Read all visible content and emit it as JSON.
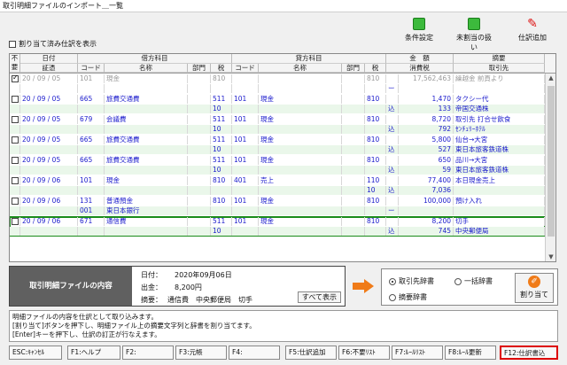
{
  "window": {
    "title": "取引明細ファイルのインポート＿一覧"
  },
  "toolbar": {
    "unallocated_label": "割り当て済み仕訳を表示",
    "condition_label": "条件設定",
    "unallocated_handling_label": "未割当の扱い",
    "add_entry_label": "仕訳追加"
  },
  "grid": {
    "headers": {
      "fuyo": "不要",
      "date": "日付",
      "voucher": "証憑",
      "debit_group": "借方科目",
      "credit_group": "貸方科目",
      "code": "コード",
      "name": "名称",
      "dept": "部門",
      "tax": "税",
      "amount_group": "金　額",
      "consumption_tax": "消費税",
      "summary_group": "摘要",
      "partner": "取引先"
    },
    "rows": [
      {
        "date": "20 / 09 / 05",
        "dcode": "101",
        "dname": "現金",
        "dtax": "810",
        "ccode": "",
        "cname": "",
        "ctax": "810",
        "amount": "17,562,463",
        "summary": "繰越金 前頁より",
        "checked": true,
        "gray": true,
        "sub": {
          "dtax": "",
          "ctax": "",
          "ztype": "ー",
          "ztax": "",
          "partner": ""
        }
      },
      {
        "date": "20 / 09 / 05",
        "dcode": "665",
        "dname": "旅費交通費",
        "dtax": "511",
        "ccode": "101",
        "cname": "現金",
        "ctax": "810",
        "amount": "1,470",
        "summary": "タクシー代",
        "sub": {
          "dtax": "10",
          "ctax": "",
          "ztype": "込",
          "ztax": "133",
          "partner": "帝国交通株"
        }
      },
      {
        "date": "20 / 09 / 05",
        "dcode": "679",
        "dname": "会議費",
        "dtax": "511",
        "ccode": "101",
        "cname": "現金",
        "ctax": "810",
        "amount": "8,720",
        "summary": "取引先 打合せ飲食",
        "sub": {
          "dtax": "10",
          "ctax": "",
          "ztype": "込",
          "ztax": "792",
          "partner": "ｾﾝﾁｭﾘｰﾎﾃﾙ"
        }
      },
      {
        "date": "20 / 09 / 05",
        "dcode": "665",
        "dname": "旅費交通費",
        "dtax": "511",
        "ccode": "101",
        "cname": "現金",
        "ctax": "810",
        "amount": "5,800",
        "summary": "仙台→大宮",
        "sub": {
          "dtax": "10",
          "ctax": "",
          "ztype": "込",
          "ztax": "527",
          "partner": "東日本旅客鉄道株"
        }
      },
      {
        "date": "20 / 09 / 05",
        "dcode": "665",
        "dname": "旅費交通費",
        "dtax": "511",
        "ccode": "101",
        "cname": "現金",
        "ctax": "810",
        "amount": "650",
        "summary": "品川→大宮",
        "sub": {
          "dtax": "10",
          "ctax": "",
          "ztype": "込",
          "ztax": "59",
          "partner": "東日本旅客鉄道株"
        }
      },
      {
        "date": "20 / 09 / 06",
        "dcode": "101",
        "dname": "現金",
        "dtax": "810",
        "ccode": "401",
        "cname": "売上",
        "ctax": "110",
        "amount": "77,400",
        "summary": "本日現金売上",
        "sub": {
          "dtax": "",
          "ctax": "10",
          "ztype": "込",
          "ztax": "7,036",
          "partner": ""
        }
      },
      {
        "date": "20 / 09 / 06",
        "dcode": "131",
        "dname": "普通預金",
        "dtax": "810",
        "ccode": "101",
        "cname": "現金",
        "ctax": "810",
        "amount": "100,000",
        "summary": "預け入れ",
        "sub": {
          "dcode": "001",
          "dname": "東日本銀行",
          "dtax": "",
          "ctax": "",
          "ztype": "ー",
          "ztax": "",
          "partner": ""
        }
      },
      {
        "date": "20 / 09 / 06",
        "dcode": "671",
        "dname": "通信費",
        "dtax": "511",
        "ccode": "101",
        "cname": "現金",
        "ctax": "810",
        "amount": "8,200",
        "summary": "切手",
        "selected": true,
        "sub": {
          "dtax": "10",
          "ctax": "",
          "ztype": "込",
          "ztax": "745",
          "partner": "中央郵便局"
        }
      }
    ]
  },
  "info": {
    "title": "取引明細ファイルの内容",
    "date_label": "日付：",
    "date_value": "2020年09月06日",
    "out_label": "出金：",
    "out_value": "8,200円",
    "summary_label": "摘要：",
    "summary_value": "通信費　中央郵便局　切手",
    "show_all": "すべて表示"
  },
  "dict": {
    "partner_dict": "取引先辞書",
    "bulk_dict": "一括辞書",
    "summary_dict": "摘要辞書",
    "assign": "割り当て"
  },
  "message": {
    "line1": "明細ファイルの内容を仕訳として取り込みます。",
    "line2": "[割り当て]ボタンを押下し、明細ファイル上の摘要文字列と辞書を割り当てます。",
    "line3": "[Enter]キーを押下し、仕訳の訂正が行なえます。"
  },
  "fkeys": {
    "esc": "ESC:ｷｬﾝｾﾙ",
    "f1": "F1:ヘルプ",
    "f2": "F2:",
    "f3": "F3:元帳",
    "f4": "F4:",
    "f5": "F5:仕訳追加",
    "f6": "F6:不要ﾘｽﾄ",
    "f7": "F7:ﾙｰﾙﾘｽﾄ",
    "f8": "F8:ﾙｰﾙ更新",
    "f12": "F12:仕訳書込"
  },
  "colors": {
    "green": "#eaf7ea",
    "blue": "#1a1acc",
    "highlight": "#d00000",
    "info_bg": "#606060"
  }
}
